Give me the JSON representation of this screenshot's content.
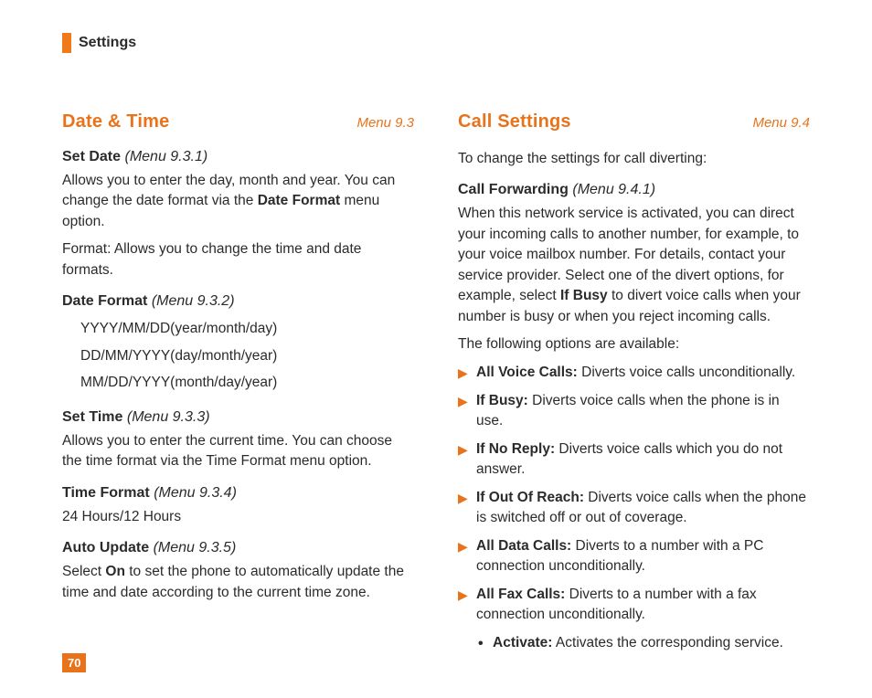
{
  "header": {
    "title": "Settings"
  },
  "page_number": "70",
  "left": {
    "section_title": "Date & Time",
    "section_menu": "Menu 9.3",
    "set_date": {
      "title": "Set Date",
      "menu": "(Menu 9.3.1)",
      "p1a": "Allows you to enter the day, month and year. You can change the date format via the ",
      "p1b": "Date Format",
      "p1c": " menu option.",
      "p2": "Format: Allows you to change the time and date formats."
    },
    "date_format": {
      "title": "Date Format",
      "menu": "(Menu 9.3.2)",
      "opt1": "YYYY/MM/DD(year/month/day)",
      "opt2": "DD/MM/YYYY(day/month/year)",
      "opt3": "MM/DD/YYYY(month/day/year)"
    },
    "set_time": {
      "title": "Set Time",
      "menu": "(Menu 9.3.3)",
      "p1": "Allows you to enter the current time. You can choose the time format via the Time Format menu option."
    },
    "time_format": {
      "title": "Time Format",
      "menu": "(Menu 9.3.4)",
      "p1": "24 Hours/12 Hours"
    },
    "auto_update": {
      "title": "Auto Update",
      "menu": "(Menu 9.3.5)",
      "p1a": "Select ",
      "p1b": "On",
      "p1c": " to set the phone to automatically update the time and date according to the current time zone."
    }
  },
  "right": {
    "section_title": "Call Settings",
    "section_menu": "Menu 9.4",
    "intro": "To change the settings for call diverting:",
    "call_forwarding": {
      "title": "Call Forwarding",
      "menu": "(Menu 9.4.1)",
      "p1a": "When this network service is activated, you can direct your incoming calls to another number, for example, to your voice mailbox number. For details, contact your service provider. Select one of the divert options, for example, select ",
      "p1b": "If Busy",
      "p1c": " to divert voice calls when your number is busy or when you reject incoming calls.",
      "p2": "The following options are available:",
      "items": [
        {
          "label": "All Voice Calls:",
          "desc": " Diverts voice calls unconditionally."
        },
        {
          "label": "If Busy:",
          "desc": " Diverts voice calls when the phone is in use."
        },
        {
          "label": "If No Reply:",
          "desc": " Diverts voice calls which you do not answer."
        },
        {
          "label": "If Out Of Reach:",
          "desc": " Diverts voice calls when the phone is switched off or out of coverage."
        },
        {
          "label": "All Data Calls:",
          "desc": " Diverts to a number with a PC connection unconditionally."
        },
        {
          "label": "All Fax Calls:",
          "desc": " Diverts to a number with a fax connection unconditionally."
        }
      ],
      "activate_label": "Activate:",
      "activate_desc": " Activates the corresponding service."
    }
  }
}
